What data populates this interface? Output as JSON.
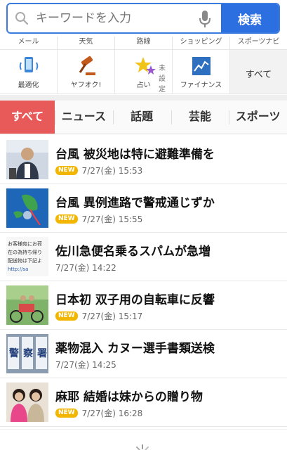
{
  "search": {
    "placeholder": "キーワードを入力",
    "button_label": "検索"
  },
  "service_top_labels": [
    "メール",
    "天気",
    "路線",
    "ショッピング",
    "スポーツナビ"
  ],
  "services": [
    {
      "label": "最適化",
      "icon": "phone-optimize-icon"
    },
    {
      "label": "ヤフオク!",
      "icon": "auction-gavel-icon"
    },
    {
      "label": "占い",
      "side": "未設定",
      "icon": "fortune-stars-icon"
    },
    {
      "label": "ファイナンス",
      "icon": "finance-chart-icon"
    },
    {
      "label": "すべて",
      "icon": ""
    }
  ],
  "tabs": [
    {
      "label": "すべて",
      "active": true
    },
    {
      "label": "ニュース",
      "active": false
    },
    {
      "label": "話題",
      "active": false
    },
    {
      "label": "芸能",
      "active": false
    },
    {
      "label": "スポーツ",
      "active": false
    }
  ],
  "news": [
    {
      "title": "台風 被災地は特に避難準備を",
      "new": true,
      "new_label": "NEW",
      "date": "7/27(金) 15:53"
    },
    {
      "title": "台風 異例進路で警戒通じずか",
      "new": true,
      "new_label": "NEW",
      "date": "7/27(金) 15:55"
    },
    {
      "title": "佐川急便名乗るスパムが急増",
      "new": false,
      "new_label": "",
      "date": "7/27(金) 14:22"
    },
    {
      "title": "日本初 双子用の自転車に反響",
      "new": true,
      "new_label": "NEW",
      "date": "7/27(金) 15:17"
    },
    {
      "title": "薬物混入 カヌー選手書類送検",
      "new": false,
      "new_label": "",
      "date": "7/27(金) 14:25"
    },
    {
      "title": "麻耶 結婚は妹からの贈り物",
      "new": true,
      "new_label": "NEW",
      "date": "7/27(金) 16:28"
    }
  ],
  "thumb_text": {
    "spam": [
      "お客様宛にお荷",
      "在の為持ち帰り",
      "配送物は下記よ",
      "http://sa"
    ],
    "police": [
      "警",
      "察",
      "署"
    ]
  },
  "colors": {
    "accent": "#2b6fe0",
    "active_tab": "#e85a5a",
    "new_badge": "#f3b600"
  }
}
